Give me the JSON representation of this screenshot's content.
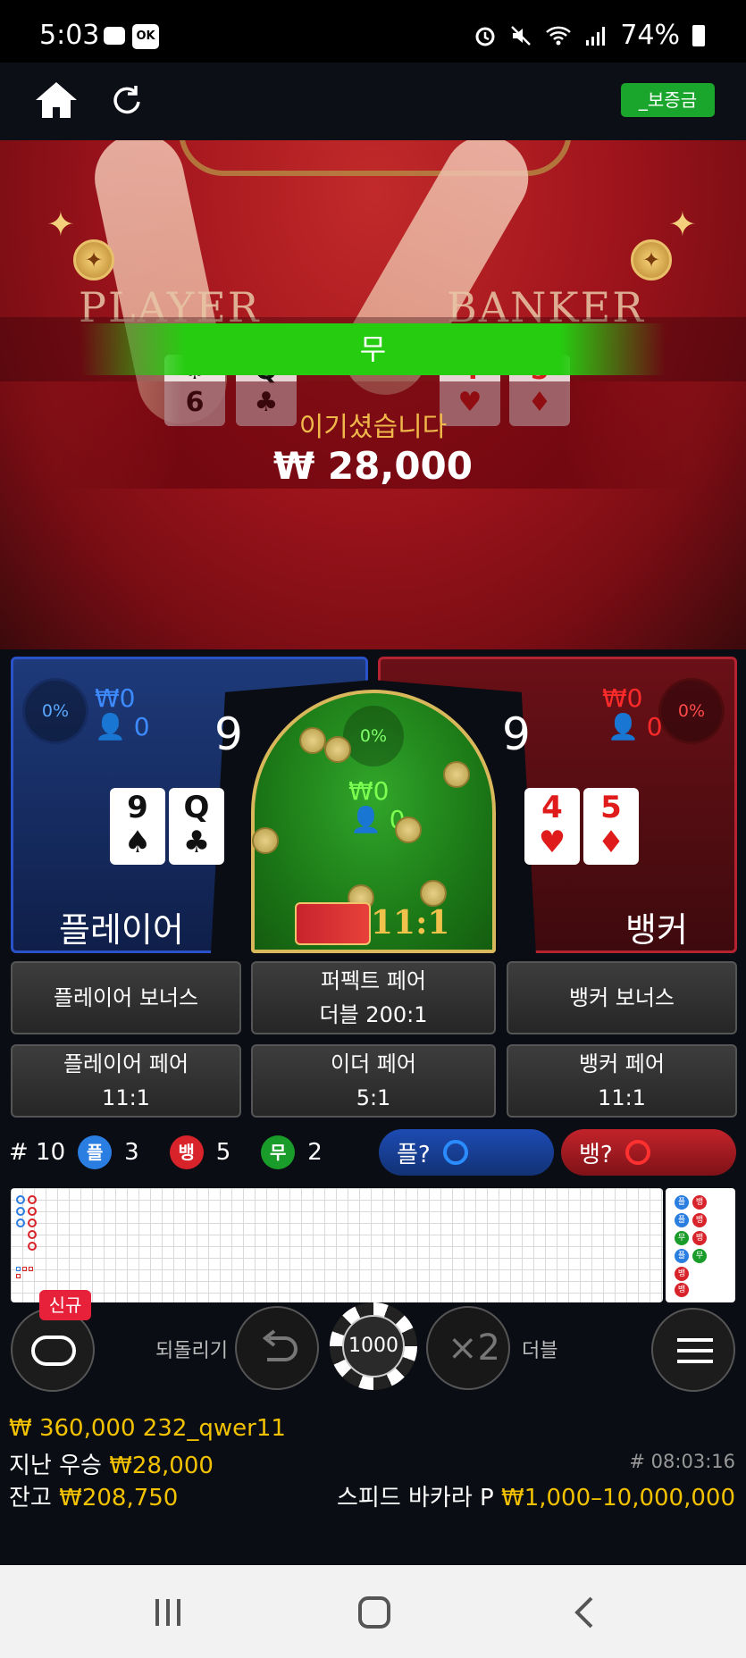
{
  "status_bar": {
    "time": "5:03",
    "ok_badge": "OK",
    "battery": "74%"
  },
  "nav": {
    "deposit_label": "_보증금"
  },
  "video": {
    "player_word": "PLAYER",
    "banker_word": "BANKER",
    "result_label": "무",
    "win_message": "이기셨습니다",
    "win_amount": "₩ 28,000",
    "cards": {
      "player": [
        {
          "rank": "6",
          "suit": "♠"
        },
        {
          "rank": "Q",
          "suit": "♣"
        }
      ],
      "banker": [
        {
          "rank": "4",
          "suit": "♥"
        },
        {
          "rank": "5",
          "suit": "♦"
        }
      ]
    }
  },
  "bets": {
    "player": {
      "percent": "0%",
      "amount": "₩0",
      "count": "0",
      "score": "9",
      "label": "플레이어",
      "cards": [
        {
          "rank": "9",
          "suit": "♠"
        },
        {
          "rank": "Q",
          "suit": "♣"
        }
      ]
    },
    "tie": {
      "percent": "0%",
      "amount": "₩0",
      "count": "0",
      "odds": "11:1"
    },
    "banker": {
      "percent": "0%",
      "amount": "₩0",
      "count": "0",
      "score": "9",
      "label": "뱅커",
      "cards": [
        {
          "rank": "4",
          "suit": "♥"
        },
        {
          "rank": "5",
          "suit": "♦"
        }
      ]
    }
  },
  "side_bets": {
    "player_bonus": "플레이어 보너스",
    "perfect_pair": "퍼펙트 페어",
    "perfect_pair_odds": "더블 200:1",
    "banker_bonus": "뱅커 보너스",
    "player_pair": "플레이어 페어",
    "player_pair_odds": "11:1",
    "either_pair": "이더 페어",
    "either_pair_odds": "5:1",
    "banker_pair": "뱅커 페어",
    "banker_pair_odds": "11:1"
  },
  "stats": {
    "round": "# 10",
    "player_icon": "플",
    "player_count": "3",
    "banker_icon": "뱅",
    "banker_count": "5",
    "tie_icon": "무",
    "tie_count": "2",
    "player_predict": "플?",
    "banker_predict": "뱅?"
  },
  "road_side": {
    "player_icon": "플",
    "banker_icon": "뱅",
    "tie_icon": "무"
  },
  "controls": {
    "new_badge": "신규",
    "undo_label": "되돌리기",
    "chip_value": "1000",
    "double_symbol": "×2",
    "double_label": "더블"
  },
  "footer": {
    "account_line": "₩ 360,000 232_qwer11",
    "last_win_label": "지난 우승",
    "last_win_amount": "₩28,000",
    "balance_label": "잔고",
    "balance_amount": "₩208,750",
    "game_id": "# 08:03:16",
    "table_name": "스피드 바카라 P",
    "table_limits": "₩1,000–10,000,000"
  },
  "colors": {
    "player": "#2a52c9",
    "banker": "#b52330",
    "tie": "#1c7a17",
    "accent_gold": "#d9b85c",
    "highlight_yellow": "#f2c200"
  },
  "icons": [
    "home-icon",
    "refresh-icon",
    "undo-icon",
    "menu-icon",
    "lobby-icon",
    "recent-apps-icon",
    "home-button-icon",
    "back-icon"
  ]
}
